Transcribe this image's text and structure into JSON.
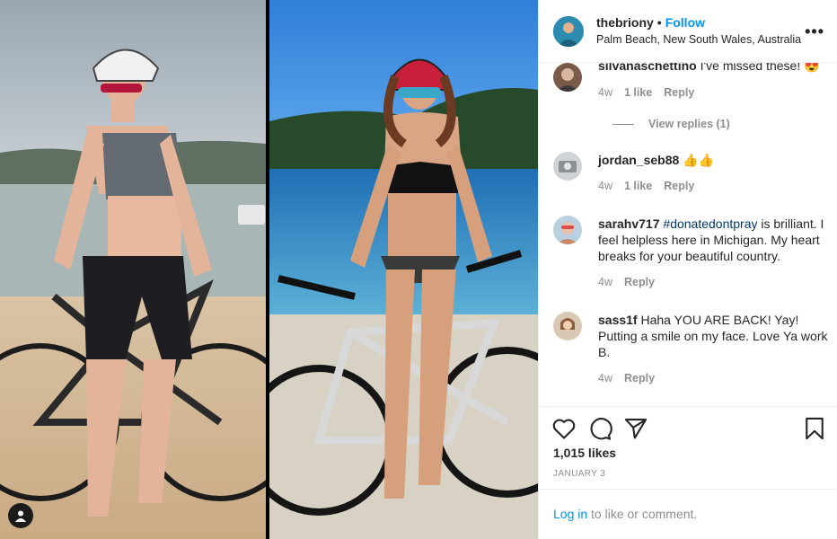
{
  "post": {
    "username": "thebriony",
    "separator": "•",
    "follow_label": "Follow",
    "location": "Palm Beach, New South Wales, Australia",
    "more_label": "•••"
  },
  "comments": [
    {
      "user": "silvanaschettino",
      "text": "I've missed these! 😍",
      "age": "4w",
      "likes": "1 like",
      "reply": "Reply",
      "view_replies": "View replies (1)"
    },
    {
      "user": "jordan_seb88",
      "text": "👍👍",
      "age": "4w",
      "likes": "1 like",
      "reply": "Reply"
    },
    {
      "user": "sarahv717",
      "hashtag": "#donatedontpray",
      "text": " is brilliant. I feel helpless here in Michigan. My heart breaks for your beautiful country.",
      "age": "4w",
      "reply": "Reply"
    },
    {
      "user": "sass1f",
      "text": "Haha YOU ARE BACK! Yay! Putting a smile on my face. Love Ya work B.",
      "age": "4w",
      "reply": "Reply"
    }
  ],
  "stats": {
    "likes": "1,015 likes",
    "date": "JANUARY 3"
  },
  "footer": {
    "login_link": "Log in",
    "login_text": " to like or comment."
  },
  "icons": {
    "like": "heart-icon",
    "comment": "comment-icon",
    "share": "paper-plane-icon",
    "save": "bookmark-icon",
    "user_tag": "user-icon"
  },
  "colors": {
    "accent": "#0095f6",
    "hashtag": "#00376b",
    "muted": "#8e8e8e",
    "text": "#262626"
  }
}
